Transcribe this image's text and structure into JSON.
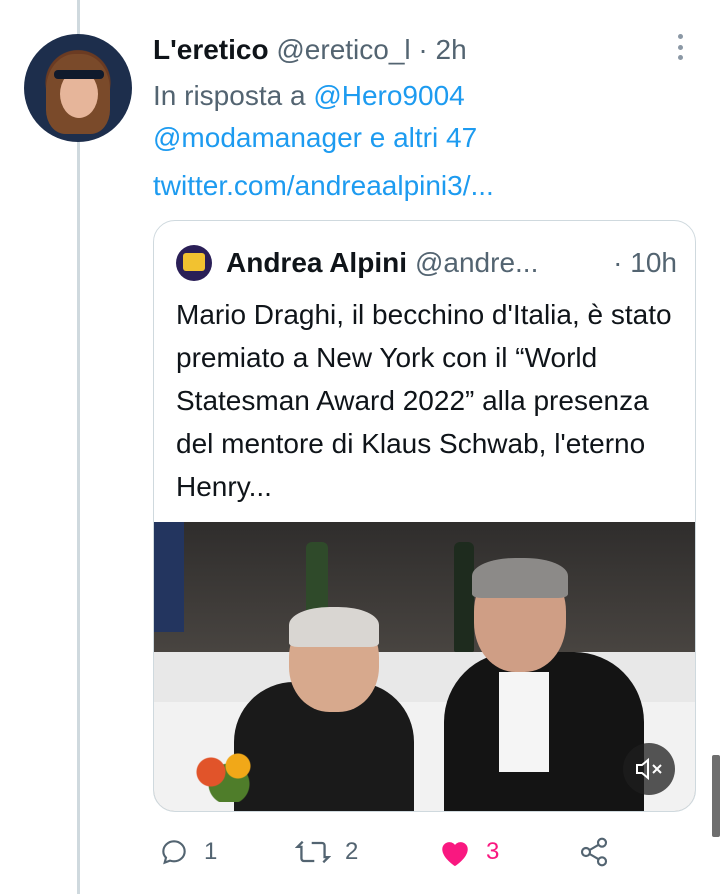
{
  "tweet": {
    "author_name": "L'eretico",
    "author_handle": "@eretico_l",
    "separator": "·",
    "time": "2h",
    "reply_prefix": "In risposta a",
    "reply_to": "@Hero9004",
    "reply_others": "@modamanager e altri 47",
    "link": "twitter.com/andreaalpini3/..."
  },
  "quote": {
    "author_name": "Andrea Alpini",
    "author_handle": "@andre...",
    "separator": "·",
    "time": "10h",
    "text": "Mario Draghi, il becchino d'Italia, è stato premiato a New York con il “World Statesman Award 2022” alla presenza del mentore di Klaus Schwab, l'eterno Henry..."
  },
  "actions": {
    "reply_count": "1",
    "retweet_count": "2",
    "like_count": "3",
    "like_color": "#f91880"
  },
  "colors": {
    "link": "#1d9bf0",
    "muted": "#536471",
    "border": "#cfd9de"
  }
}
